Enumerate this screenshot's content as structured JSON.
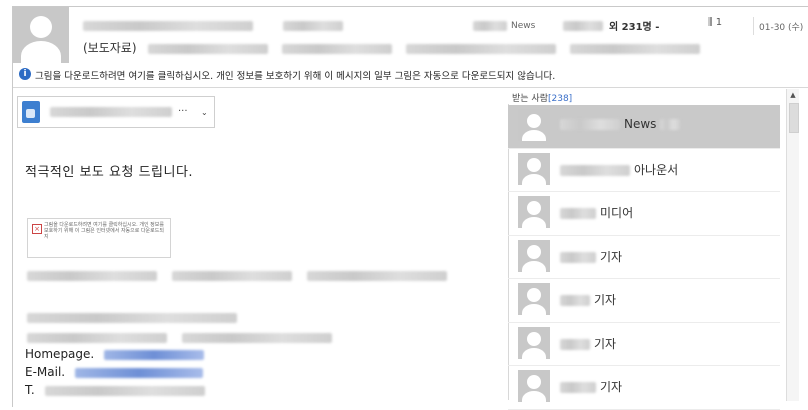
{
  "header": {
    "sender_news_label": "News",
    "recipients_count": "외 231명 -",
    "attachment_count": "1",
    "date": "01-30 (수)",
    "subject_prefix": "(보도자료)"
  },
  "info_bar": {
    "text": "그림을 다운로드하려면 여기를 클릭하십시오. 개인 정보를 보호하기 위해 이 메시지의 일부 그림은 자동으로 다운로드되지 않습니다."
  },
  "sender_box": {
    "dots": "...",
    "caret": "⌄"
  },
  "body": {
    "greeting": "적극적인 보도 요청 드립니다.",
    "blocked_image_text": "그림을 다운로드하려면 여기를 클릭하십시오. 개인 정보를 보호하기 위해 이 그림은 인터넷에서 자동으로 다운로드되지",
    "signature": {
      "homepage_label": "Homepage.",
      "email_label": "E-Mail.",
      "phone_label": "T."
    }
  },
  "recipients_panel": {
    "title": "받는 사람",
    "count": "[238]",
    "items": [
      {
        "suffix": "News",
        "selected": true
      },
      {
        "suffix": "아나운서",
        "selected": false
      },
      {
        "suffix": "미디어",
        "selected": false
      },
      {
        "suffix": "기자",
        "selected": false
      },
      {
        "suffix": "기자",
        "selected": false
      },
      {
        "suffix": "기자",
        "selected": false
      },
      {
        "suffix": "기자",
        "selected": false
      }
    ]
  },
  "colors": {
    "selected_row": "#c9c9c9",
    "info_icon": "#2c6bc4",
    "link_blur": "#6e8fd6"
  }
}
